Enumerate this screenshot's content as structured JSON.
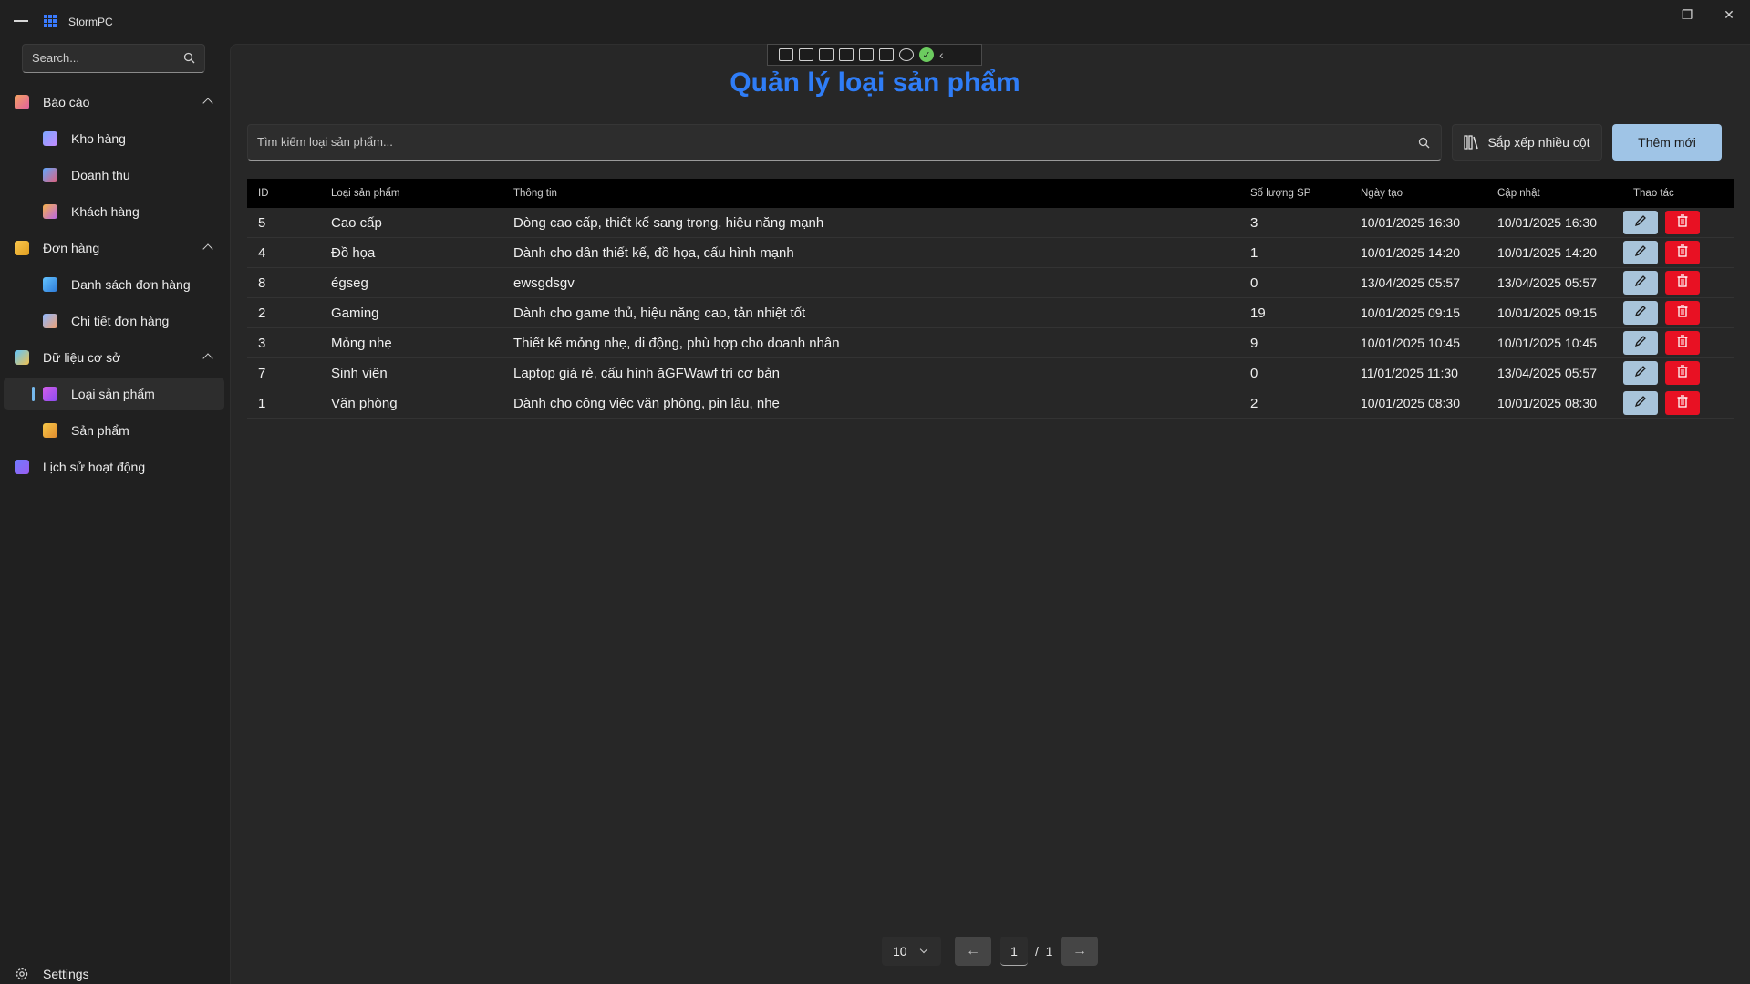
{
  "app": {
    "title": "StormPC"
  },
  "window_controls": {
    "minimize": "—",
    "restore": "❐",
    "close": "✕"
  },
  "sidebar": {
    "search_placeholder": "Search...",
    "groups": [
      {
        "label": "Báo cáo",
        "icon": "report-icon",
        "items": [
          {
            "label": "Kho hàng",
            "icon": "warehouse-icon"
          },
          {
            "label": "Doanh thu",
            "icon": "revenue-icon"
          },
          {
            "label": "Khách hàng",
            "icon": "customers-icon"
          }
        ]
      },
      {
        "label": "Đơn hàng",
        "icon": "orders-icon",
        "items": [
          {
            "label": "Danh sách đơn hàng",
            "icon": "order-list-icon"
          },
          {
            "label": "Chi tiết đơn hàng",
            "icon": "order-detail-icon"
          }
        ]
      },
      {
        "label": "Dữ liệu cơ sở",
        "icon": "database-icon",
        "items": [
          {
            "label": "Loại sản phẩm",
            "icon": "category-icon",
            "active": true
          },
          {
            "label": "Sản phẩm",
            "icon": "product-icon"
          }
        ]
      }
    ],
    "activity_log": "Lịch sử hoạt động",
    "settings": "Settings"
  },
  "page": {
    "title": "Quản lý loại sản phẩm",
    "search_placeholder": "Tìm kiếm loại sản phẩm...",
    "sort_button": "Sắp xếp nhiều cột",
    "add_button": "Thêm mới",
    "accent_color": "#2f7df7"
  },
  "table": {
    "headers": [
      "ID",
      "Loại sản phẩm",
      "Thông tin",
      "Số lượng SP",
      "Ngày tạo",
      "Cập nhật",
      "Thao tác"
    ],
    "rows": [
      {
        "id": "5",
        "name": "Cao cấp",
        "info": "Dòng cao cấp, thiết kế sang trọng, hiệu năng mạnh",
        "qty": "3",
        "created": "10/01/2025 16:30",
        "updated": "10/01/2025 16:30"
      },
      {
        "id": "4",
        "name": "Đồ họa",
        "info": "Dành cho dân thiết kế, đồ họa, cấu hình mạnh",
        "qty": "1",
        "created": "10/01/2025 14:20",
        "updated": "10/01/2025 14:20"
      },
      {
        "id": "8",
        "name": "égseg",
        "info": "ewsgdsgv",
        "qty": "0",
        "created": "13/04/2025 05:57",
        "updated": "13/04/2025 05:57"
      },
      {
        "id": "2",
        "name": "Gaming",
        "info": "Dành cho game thủ, hiệu năng cao, tản nhiệt tốt",
        "qty": "19",
        "created": "10/01/2025 09:15",
        "updated": "10/01/2025 09:15"
      },
      {
        "id": "3",
        "name": "Mỏng nhẹ",
        "info": "Thiết kế mỏng nhẹ, di động, phù hợp cho doanh nhân",
        "qty": "9",
        "created": "10/01/2025 10:45",
        "updated": "10/01/2025 10:45"
      },
      {
        "id": "7",
        "name": "Sinh viên",
        "info": "Laptop giá rẻ, cấu hình ăGFWawf trí cơ bản",
        "qty": "0",
        "created": "11/01/2025 11:30",
        "updated": "13/04/2025 05:57"
      },
      {
        "id": "1",
        "name": "Văn phòng",
        "info": "Dành cho công việc văn phòng, pin lâu, nhẹ",
        "qty": "2",
        "created": "10/01/2025 08:30",
        "updated": "10/01/2025 08:30"
      }
    ]
  },
  "pagination": {
    "page_size": "10",
    "current_page": "1",
    "separator": "/",
    "total_pages": "1"
  }
}
